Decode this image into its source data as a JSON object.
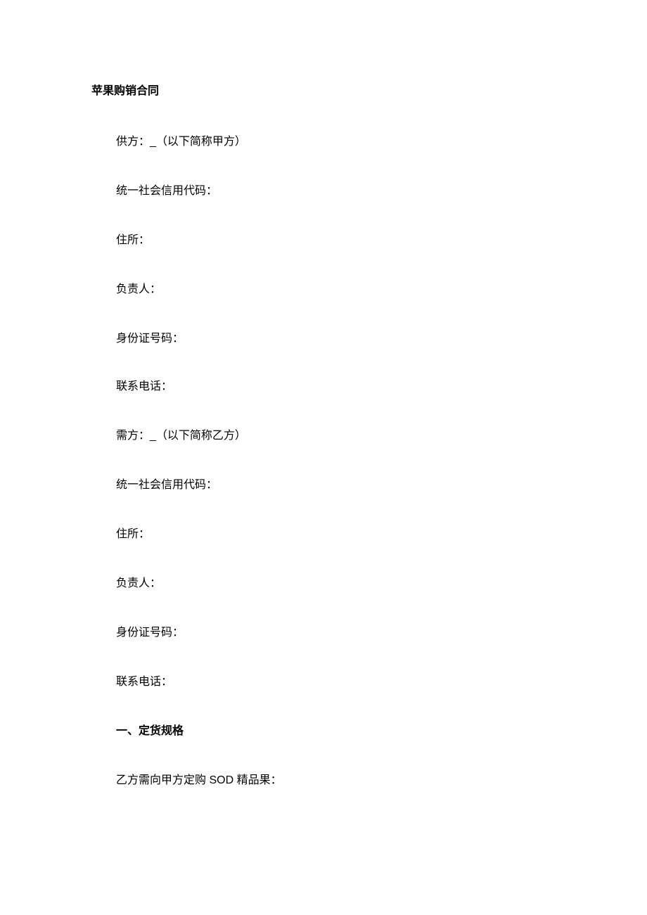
{
  "title": "苹果购销合同",
  "partyA": {
    "line": "供方：_（以下简称甲方）",
    "uscc": "统一社会信用代码：",
    "address": "住所：",
    "principal": "负责人：",
    "idNumber": "身份证号码：",
    "phone": "联系电话："
  },
  "partyB": {
    "line": "需方：_（以下简称乙方）",
    "uscc": "统一社会信用代码：",
    "address": "住所：",
    "principal": "负责人：",
    "idNumber": "身份证号码：",
    "phone": "联系电话："
  },
  "section1": {
    "heading": "一、定货规格",
    "content": "乙方需向甲方定购 SOD 精品果："
  }
}
